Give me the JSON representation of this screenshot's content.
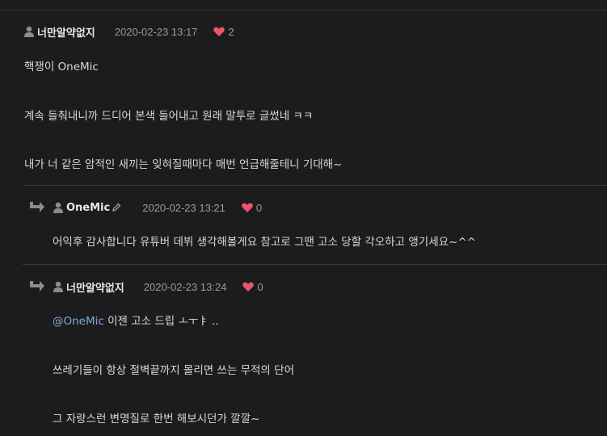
{
  "comment": {
    "author": "너만알약없지",
    "date": "2020-02-23 13:17",
    "likes": "2",
    "lines": [
      "핵쟁이 OneMic",
      "계속 들춰내니까 드디어 본색 들어내고 원래 말투로 글썼네 ㅋㅋ",
      "내가 너 같은 암적인 새끼는 잊혀질때마다 매번 언급해줄테니 기대해~"
    ]
  },
  "replies": [
    {
      "author": "OneMic",
      "date": "2020-02-23 13:21",
      "likes": "0",
      "lines": [
        "어익후 감사합니다 유튜버 데뷔 생각해볼게요 참고로 그땐 고소 당할 각오하고 앵기세요~^^"
      ]
    },
    {
      "author": "너만알약없지",
      "date": "2020-02-23 13:24",
      "likes": "0",
      "mention": "@OneMic",
      "lines": [
        " 이젠 고소 드립 ㅗㅜㅑ ..",
        "쓰레기들이 항상 절벽끝까지 몰리면 쓰는 무적의 단어",
        "그 자랑스런 변명질로 한번 해보시던가 깔깔~"
      ]
    }
  ],
  "colors": {
    "background": "#1c1c1e",
    "heart": "#e8566e",
    "mention": "#7fa7d6"
  },
  "icons": [
    "user-icon",
    "heart-icon",
    "reply-arrow-icon",
    "pencil-icon"
  ]
}
